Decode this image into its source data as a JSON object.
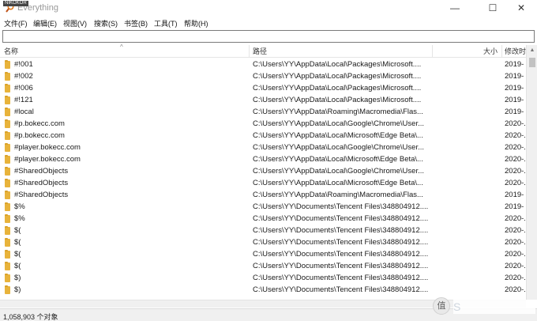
{
  "window": {
    "title": "Everything",
    "overlay_tag": "NIKOKOR",
    "minimize_symbol": "—",
    "maximize_symbol": "☐",
    "close_symbol": "✕"
  },
  "menu": [
    "文件(F)",
    "编辑(E)",
    "视图(V)",
    "搜索(S)",
    "书签(B)",
    "工具(T)",
    "帮助(H)"
  ],
  "search": {
    "value": "",
    "placeholder": ""
  },
  "columns": {
    "name": "名称",
    "path": "路径",
    "size": "大小",
    "date": "修改时"
  },
  "sort_indicator": "^",
  "icons": {
    "folder": "folder-icon",
    "app": "magnifier-app-icon"
  },
  "colors": {
    "folder": "#e8b33b",
    "title_inactive": "#999999"
  },
  "rows": [
    {
      "name": "#!001",
      "path": "C:\\Users\\YY\\AppData\\Local\\Packages\\Microsoft....",
      "date": "2019-"
    },
    {
      "name": "#!002",
      "path": "C:\\Users\\YY\\AppData\\Local\\Packages\\Microsoft....",
      "date": "2019-"
    },
    {
      "name": "#!006",
      "path": "C:\\Users\\YY\\AppData\\Local\\Packages\\Microsoft....",
      "date": "2019-"
    },
    {
      "name": "#!121",
      "path": "C:\\Users\\YY\\AppData\\Local\\Packages\\Microsoft....",
      "date": "2019-"
    },
    {
      "name": "#local",
      "path": "C:\\Users\\YY\\AppData\\Roaming\\Macromedia\\Flas...",
      "date": "2019-"
    },
    {
      "name": "#p.bokecc.com",
      "path": "C:\\Users\\YY\\AppData\\Local\\Google\\Chrome\\User...",
      "date": "2020-."
    },
    {
      "name": "#p.bokecc.com",
      "path": "C:\\Users\\YY\\AppData\\Local\\Microsoft\\Edge Beta\\...",
      "date": "2020-."
    },
    {
      "name": "#player.bokecc.com",
      "path": "C:\\Users\\YY\\AppData\\Local\\Google\\Chrome\\User...",
      "date": "2020-."
    },
    {
      "name": "#player.bokecc.com",
      "path": "C:\\Users\\YY\\AppData\\Local\\Microsoft\\Edge Beta\\...",
      "date": "2020-."
    },
    {
      "name": "#SharedObjects",
      "path": "C:\\Users\\YY\\AppData\\Local\\Google\\Chrome\\User...",
      "date": "2020-."
    },
    {
      "name": "#SharedObjects",
      "path": "C:\\Users\\YY\\AppData\\Local\\Microsoft\\Edge Beta\\...",
      "date": "2020-."
    },
    {
      "name": "#SharedObjects",
      "path": "C:\\Users\\YY\\AppData\\Roaming\\Macromedia\\Flas...",
      "date": "2019-"
    },
    {
      "name": "$%",
      "path": "C:\\Users\\YY\\Documents\\Tencent Files\\348804912....",
      "date": "2019-"
    },
    {
      "name": "$%",
      "path": "C:\\Users\\YY\\Documents\\Tencent Files\\348804912....",
      "date": "2020-."
    },
    {
      "name": "$(",
      "path": "C:\\Users\\YY\\Documents\\Tencent Files\\348804912....",
      "date": "2020-."
    },
    {
      "name": "$(",
      "path": "C:\\Users\\YY\\Documents\\Tencent Files\\348804912....",
      "date": "2020-."
    },
    {
      "name": "$(",
      "path": "C:\\Users\\YY\\Documents\\Tencent Files\\348804912....",
      "date": "2020-."
    },
    {
      "name": "$(",
      "path": "C:\\Users\\YY\\Documents\\Tencent Files\\348804912....",
      "date": "2020-."
    },
    {
      "name": "$)",
      "path": "C:\\Users\\YY\\Documents\\Tencent Files\\348804912....",
      "date": "2020-."
    },
    {
      "name": "$)",
      "path": "C:\\Users\\YY\\Documents\\Tencent Files\\348804912....",
      "date": "2020-."
    }
  ],
  "status": {
    "text": "1,058,903 个对象"
  },
  "watermark": {
    "glyph": "值",
    "text": "S"
  }
}
